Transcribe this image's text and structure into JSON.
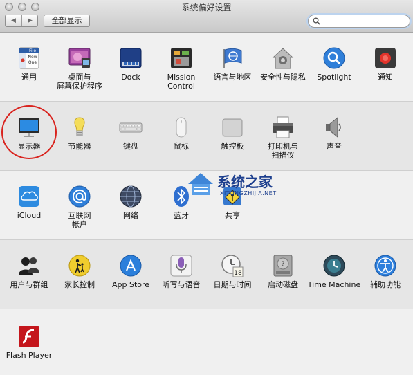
{
  "window": {
    "title": "系统偏好设置"
  },
  "toolbar": {
    "back_label": "◀",
    "forward_label": "▶",
    "show_all_label": "全部显示",
    "search_value": ""
  },
  "rows": [
    [
      {
        "label": "通用"
      },
      {
        "label": "桌面与\n屏幕保护程序"
      },
      {
        "label": "Dock"
      },
      {
        "label": "Mission\nControl"
      },
      {
        "label": "语言与地区"
      },
      {
        "label": "安全性与隐私"
      },
      {
        "label": "Spotlight"
      },
      {
        "label": "通知"
      }
    ],
    [
      {
        "label": "显示器"
      },
      {
        "label": "节能器"
      },
      {
        "label": "键盘"
      },
      {
        "label": "鼠标"
      },
      {
        "label": "触控板"
      },
      {
        "label": "打印机与\n扫描仪"
      },
      {
        "label": "声音"
      }
    ],
    [
      {
        "label": "iCloud"
      },
      {
        "label": "互联网\n帐户"
      },
      {
        "label": "网络"
      },
      {
        "label": "蓝牙"
      },
      {
        "label": "共享"
      }
    ],
    [
      {
        "label": "用户与群组"
      },
      {
        "label": "家长控制"
      },
      {
        "label": "App Store"
      },
      {
        "label": "听写与语音"
      },
      {
        "label": "日期与时间"
      },
      {
        "label": "启动磁盘"
      },
      {
        "label": "Time Machine"
      },
      {
        "label": "辅助功能"
      }
    ],
    [
      {
        "label": "Flash Player"
      }
    ]
  ],
  "icons": {
    "general_file_text": "File",
    "general_new_text": "New",
    "general_one_text": "One",
    "date_day": "18"
  },
  "watermark": {
    "main": "系统之家",
    "sub": "XITONGZHIJIA.NET"
  },
  "colors": {
    "highlight_circle": "#d9231e",
    "row_alt": "#e6e6e6",
    "row": "#f0f0f0"
  }
}
